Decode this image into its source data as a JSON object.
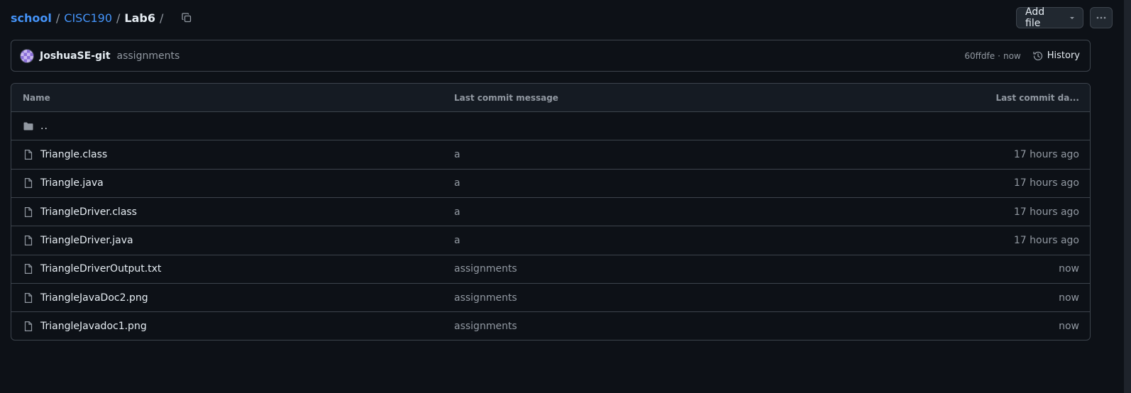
{
  "breadcrumb": {
    "items": [
      "school",
      "CISC190"
    ],
    "current": "Lab6",
    "separator": "/"
  },
  "header": {
    "add_file_label": "Add file"
  },
  "commit": {
    "author": "JoshuaSE-git",
    "message": "assignments",
    "sha": "60ffdfe",
    "dot": "·",
    "time": "now",
    "history_label": "History"
  },
  "table": {
    "columns": [
      "Name",
      "Last commit message",
      "Last commit da..."
    ],
    "parent_label": "..",
    "rows": [
      {
        "name": "Triangle.class",
        "message": "a",
        "date": "17 hours ago"
      },
      {
        "name": "Triangle.java",
        "message": "a",
        "date": "17 hours ago"
      },
      {
        "name": "TriangleDriver.class",
        "message": "a",
        "date": "17 hours ago"
      },
      {
        "name": "TriangleDriver.java",
        "message": "a",
        "date": "17 hours ago"
      },
      {
        "name": "TriangleDriverOutput.txt",
        "message": "assignments",
        "date": "now"
      },
      {
        "name": "TriangleJavaDoc2.png",
        "message": "assignments",
        "date": "now"
      },
      {
        "name": "TriangleJavadoc1.png",
        "message": "assignments",
        "date": "now"
      }
    ]
  },
  "icons": {
    "copy": "copy-icon",
    "caret": "triangle-down-icon",
    "more": "kebab-horizontal-icon",
    "history": "history-icon",
    "folder": "folder-icon",
    "file": "file-icon"
  },
  "colors": {
    "background": "#0d1117",
    "link": "#4493f8",
    "border": "#3d444d",
    "muted": "#9198a1",
    "header_bg": "#151b23"
  }
}
